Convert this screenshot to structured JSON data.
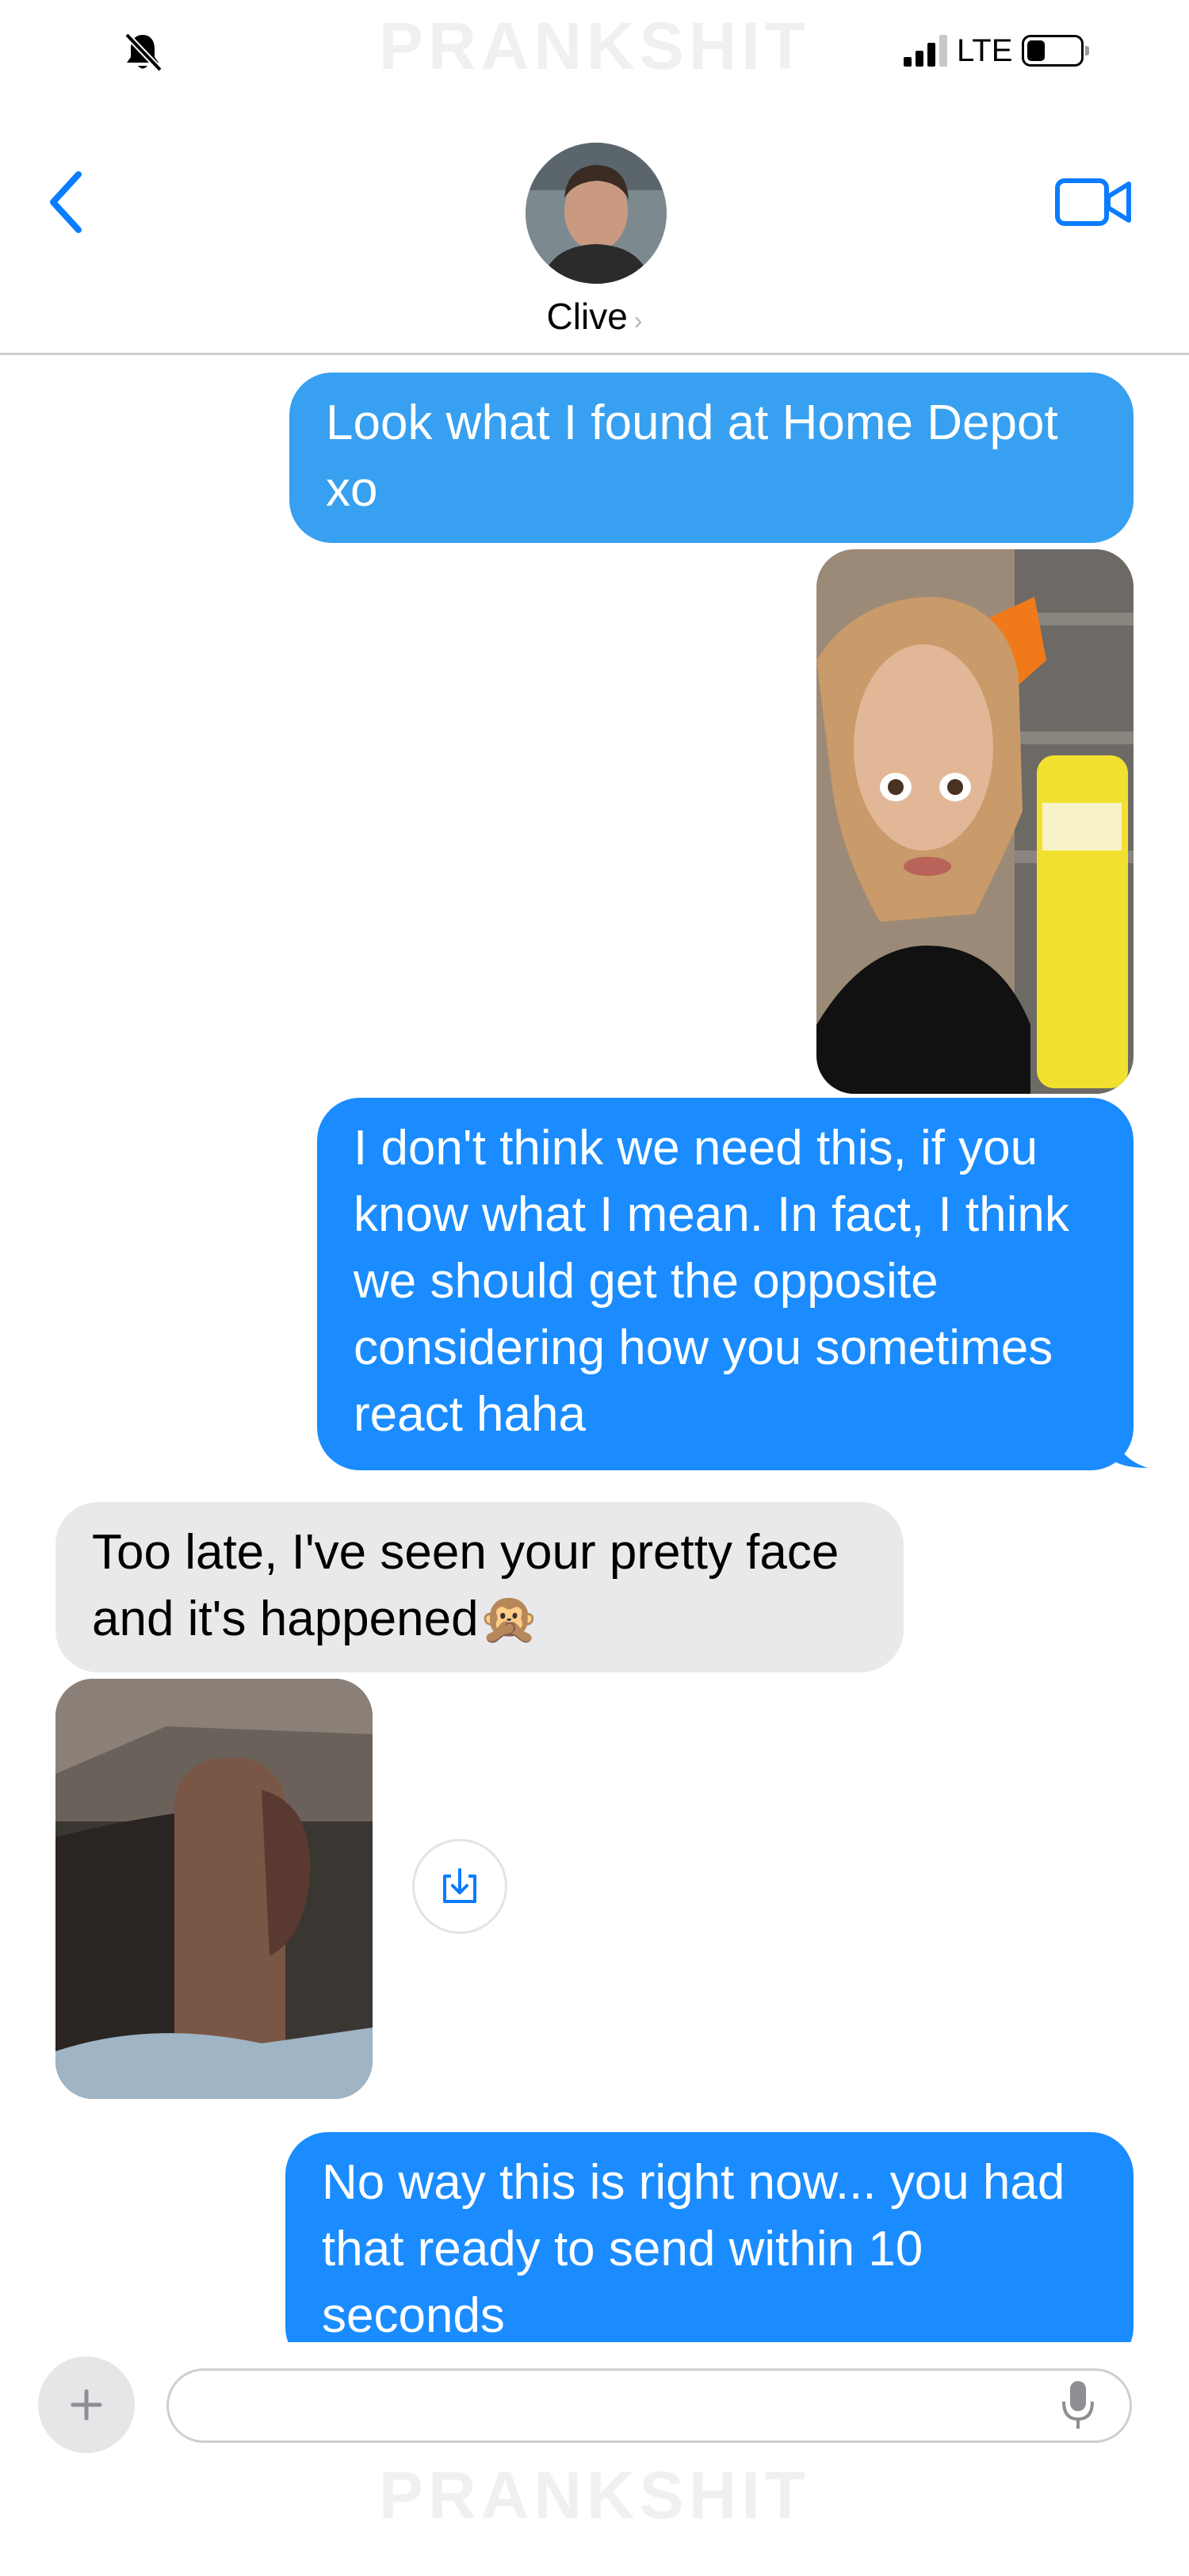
{
  "watermark": {
    "text": "PRANKSHIT"
  },
  "status_bar": {
    "network": "LTE",
    "signal_bars": 3,
    "signal_bars_total": 4,
    "battery_level": 0.35
  },
  "header": {
    "contact_name": "Clive"
  },
  "messages": [
    {
      "direction": "outgoing",
      "type": "text",
      "text": "Look what I found at Home Depot xo"
    },
    {
      "direction": "outgoing",
      "type": "photo"
    },
    {
      "direction": "outgoing",
      "type": "text",
      "text": "I don't think we need this, if you know what I mean. In fact, I think we should get the opposite considering how you sometimes react haha"
    },
    {
      "direction": "incoming",
      "type": "text",
      "text": "Too late, I've seen your pretty face and it's happened🙊"
    },
    {
      "direction": "incoming",
      "type": "photo"
    },
    {
      "direction": "outgoing",
      "type": "text",
      "text": "No way this is right now... you had that ready to send within 10 seconds"
    }
  ],
  "composer": {
    "value": "",
    "placeholder": ""
  },
  "colors": {
    "outgoing_bubble": "#1a8cff",
    "outgoing_bubble_light": "#37a0f0",
    "incoming_bubble": "#e9e9eb",
    "accent": "#0a7cff"
  },
  "icons": {
    "muted": "bell-slash-icon",
    "back": "chevron-left-icon",
    "video": "video-camera-icon",
    "save": "download-icon",
    "plus": "plus-icon",
    "mic": "microphone-icon"
  }
}
